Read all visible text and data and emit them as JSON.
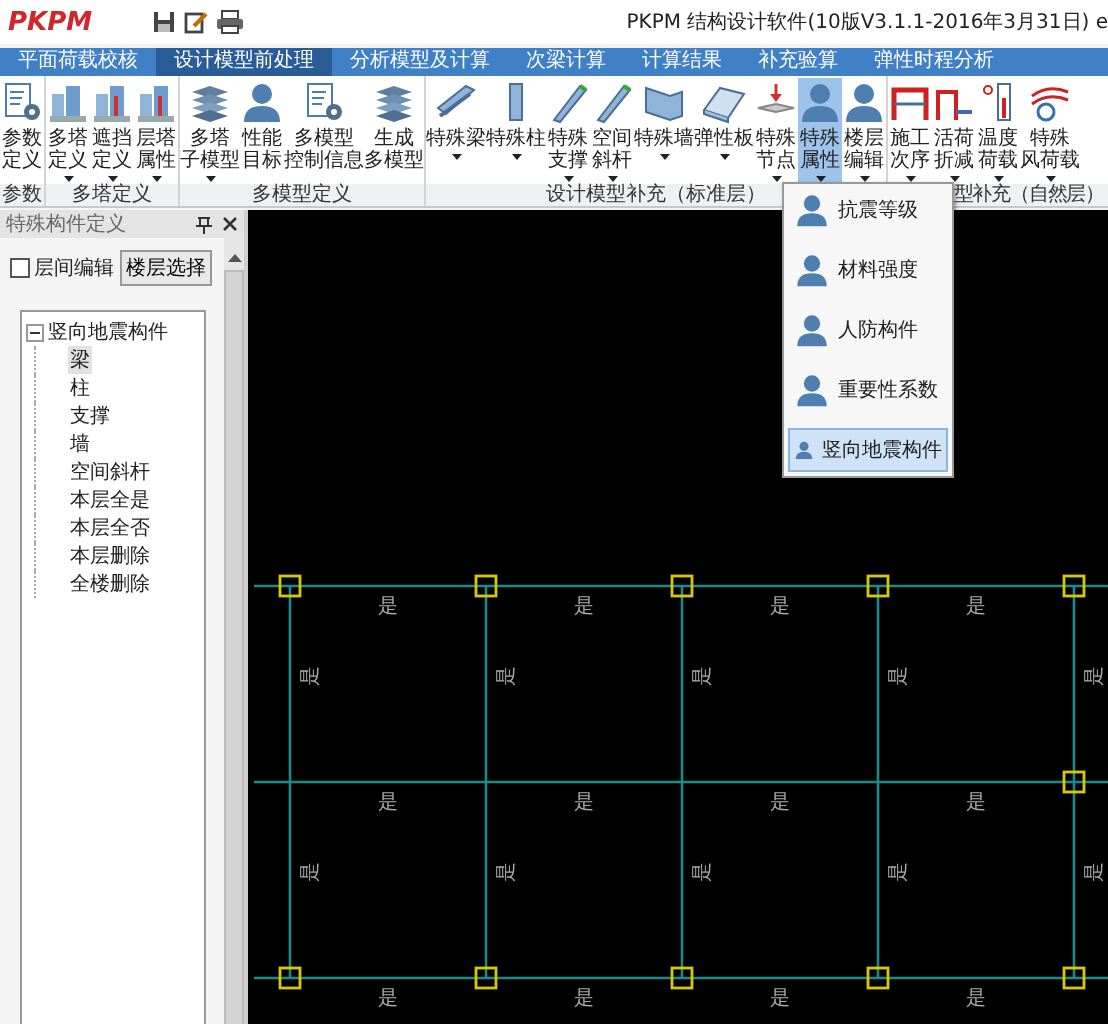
{
  "app": {
    "logo": "PKPM",
    "title": "PKPM 结构设计软件(10版V3.1.1-2016年3月31日) e"
  },
  "tabs": [
    {
      "label": "平面荷载校核",
      "selected": false
    },
    {
      "label": "设计模型前处理",
      "selected": true
    },
    {
      "label": "分析模型及计算",
      "selected": false
    },
    {
      "label": "次梁计算",
      "selected": false
    },
    {
      "label": "计算结果",
      "selected": false
    },
    {
      "label": "补充验算",
      "selected": false
    },
    {
      "label": "弹性时程分析",
      "selected": false
    }
  ],
  "ribbon": {
    "groups": [
      {
        "label": "参数",
        "buttons": [
          {
            "kind": "doc-gear",
            "lines": [
              "参数",
              "定义"
            ],
            "caret": false,
            "selected": false
          }
        ]
      },
      {
        "label": "多塔定义",
        "buttons": [
          {
            "kind": "towers",
            "lines": [
              "多塔",
              "定义"
            ],
            "caret": true,
            "selected": false
          },
          {
            "kind": "towers",
            "lines": [
              "遮挡",
              "定义"
            ],
            "caret": true,
            "selected": false
          },
          {
            "kind": "towers",
            "lines": [
              "层塔",
              "属性"
            ],
            "caret": true,
            "selected": false
          }
        ]
      },
      {
        "label": "多模型定义",
        "buttons": [
          {
            "kind": "stack",
            "lines": [
              "多塔",
              "子模型"
            ],
            "caret": true,
            "selected": false
          },
          {
            "kind": "person",
            "lines": [
              "性能",
              "目标"
            ],
            "caret": false,
            "selected": false
          },
          {
            "kind": "doc-gear",
            "lines": [
              "多模型",
              "控制信息"
            ],
            "caret": false,
            "selected": false
          },
          {
            "kind": "stack",
            "lines": [
              "生成",
              "多模型"
            ],
            "caret": false,
            "selected": false
          }
        ]
      },
      {
        "label": "设计模型补充（标准层）",
        "buttons": [
          {
            "kind": "beam",
            "lines": [
              "特殊梁"
            ],
            "caret": true,
            "selected": false
          },
          {
            "kind": "column",
            "lines": [
              "特殊柱"
            ],
            "caret": true,
            "selected": false
          },
          {
            "kind": "brace",
            "lines": [
              "特殊",
              "支撑"
            ],
            "caret": true,
            "selected": false
          },
          {
            "kind": "brace",
            "lines": [
              "空间",
              "斜杆"
            ],
            "caret": true,
            "selected": false
          },
          {
            "kind": "wall",
            "lines": [
              "特殊墙"
            ],
            "caret": true,
            "selected": false
          },
          {
            "kind": "plate",
            "lines": [
              "弹性板"
            ],
            "caret": true,
            "selected": false
          },
          {
            "kind": "node",
            "lines": [
              "特殊",
              "节点"
            ],
            "caret": true,
            "selected": false
          },
          {
            "kind": "person",
            "lines": [
              "特殊",
              "属性"
            ],
            "caret": true,
            "selected": true
          },
          {
            "kind": "person",
            "lines": [
              "楼层",
              "编辑"
            ],
            "caret": true,
            "selected": false
          }
        ]
      },
      {
        "label": "型补充（自然层）",
        "buttons": [
          {
            "kind": "frame",
            "lines": [
              "施工",
              "次序"
            ],
            "caret": true,
            "selected": false
          },
          {
            "kind": "load",
            "lines": [
              "活荷",
              "折减"
            ],
            "caret": true,
            "selected": false
          },
          {
            "kind": "thermo",
            "lines": [
              "温度",
              "荷载"
            ],
            "caret": true,
            "selected": false
          },
          {
            "kind": "wind",
            "lines": [
              "特殊",
              "风荷载"
            ],
            "caret": true,
            "selected": false
          }
        ]
      }
    ]
  },
  "panel": {
    "title": "特殊构件定义",
    "checkbox": {
      "label": "层间编辑",
      "checked": false
    },
    "button": "楼层选择",
    "tree": {
      "label": "竖向地震构件",
      "expanded": true,
      "children": [
        {
          "label": "梁",
          "selected": true
        },
        {
          "label": "柱",
          "selected": false
        },
        {
          "label": "支撑",
          "selected": false
        },
        {
          "label": "墙",
          "selected": false
        },
        {
          "label": "空间斜杆",
          "selected": false
        },
        {
          "label": "本层全是",
          "selected": false
        },
        {
          "label": "本层全否",
          "selected": false
        },
        {
          "label": "本层删除",
          "selected": false
        },
        {
          "label": "全楼删除",
          "selected": false
        }
      ]
    }
  },
  "plan": {
    "rows": [
      {
        "nodes": [
          true,
          true,
          true,
          true,
          true
        ],
        "labels": [
          "是",
          "是",
          "是",
          "是"
        ]
      },
      {
        "nodes": [
          false,
          false,
          false,
          false,
          true
        ],
        "labels": [
          "是",
          "是",
          "是",
          "是"
        ]
      },
      {
        "nodes": [
          true,
          true,
          true,
          true,
          true
        ],
        "labels": [
          "是",
          "是",
          "是",
          "是"
        ]
      }
    ],
    "bays": [
      {
        "labels": [
          "是",
          "是",
          "是",
          "是",
          "是"
        ]
      },
      {
        "labels": [
          "是",
          "是",
          "是",
          "是",
          "是"
        ]
      }
    ]
  },
  "menu": {
    "items": [
      {
        "label": "抗震等级",
        "selected": false
      },
      {
        "label": "材料强度",
        "selected": false
      },
      {
        "label": "人防构件",
        "selected": false
      },
      {
        "label": "重要性系数",
        "selected": false
      },
      {
        "label": "竖向地震构件",
        "selected": true
      }
    ]
  }
}
